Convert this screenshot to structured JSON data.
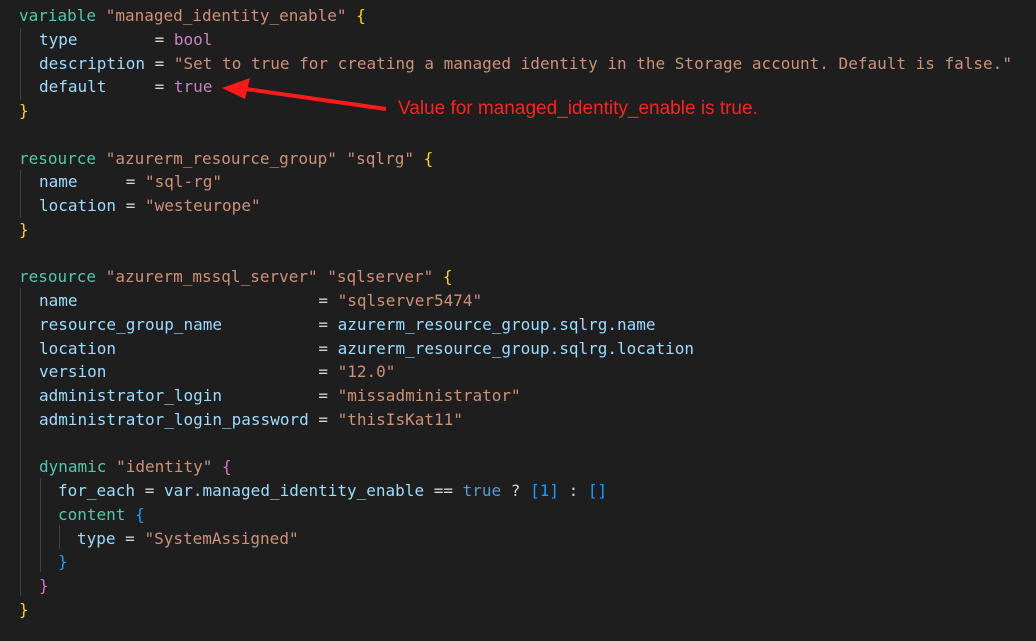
{
  "code": {
    "l1": {
      "kw": "variable",
      "name": "\"managed_identity_enable\"",
      "brace": "{"
    },
    "l2": {
      "key": "type",
      "eq": "=",
      "val": "bool"
    },
    "l3": {
      "key": "description",
      "eq": "=",
      "val": "\"Set to true for creating a managed identity in the Storage account. Default is false.\""
    },
    "l4": {
      "key": "default",
      "eq": "=",
      "val": "true"
    },
    "l5": {
      "brace": "}"
    },
    "l7": {
      "kw": "resource",
      "type": "\"azurerm_resource_group\"",
      "name": "\"sqlrg\"",
      "brace": "{"
    },
    "l8": {
      "key": "name",
      "eq": "=",
      "val": "\"sql-rg\""
    },
    "l9": {
      "key": "location",
      "eq": "=",
      "val": "\"westeurope\""
    },
    "l10": {
      "brace": "}"
    },
    "l12": {
      "kw": "resource",
      "type": "\"azurerm_mssql_server\"",
      "name": "\"sqlserver\"",
      "brace": "{"
    },
    "l13": {
      "key": "name",
      "eq": "=",
      "val": "\"sqlserver5474\""
    },
    "l14": {
      "key": "resource_group_name",
      "eq": "=",
      "val": "azurerm_resource_group.sqlrg.name"
    },
    "l15": {
      "key": "location",
      "eq": "=",
      "val": "azurerm_resource_group.sqlrg.location"
    },
    "l16": {
      "key": "version",
      "eq": "=",
      "val": "\"12.0\""
    },
    "l17": {
      "key": "administrator_login",
      "eq": "=",
      "val": "\"missadministrator\""
    },
    "l18": {
      "key": "administrator_login_password",
      "eq": "=",
      "val": "\"thisIsKat11\""
    },
    "l20": {
      "kw": "dynamic",
      "name": "\"identity\"",
      "brace": "{"
    },
    "l21": {
      "key": "for_each",
      "eq": "=",
      "ref": "var.managed_identity_enable",
      "cmp": "==",
      "bool": "true",
      "q": "?",
      "arr1": "[1]",
      "colon": ":",
      "arr2": "[]"
    },
    "l22": {
      "kw": "content",
      "brace": "{"
    },
    "l23": {
      "key": "type",
      "eq": "=",
      "val": "\"SystemAssigned\""
    },
    "l24": {
      "brace": "}"
    },
    "l25": {
      "brace": "}"
    },
    "l26": {
      "brace": "}"
    }
  },
  "annotation": {
    "text": "Value for managed_identity_enable is true.",
    "color": "#ff2020"
  }
}
